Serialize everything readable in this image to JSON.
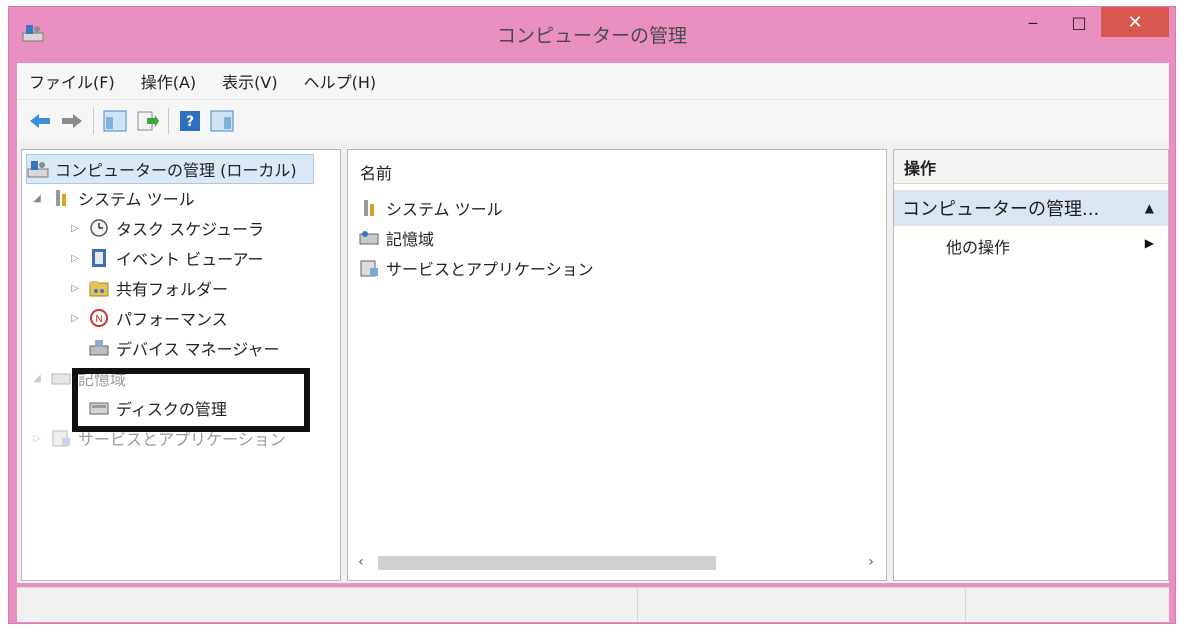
{
  "window": {
    "title": "コンピューターの管理"
  },
  "caption": {
    "minimize": "‒",
    "maximize": "□",
    "close": "✕"
  },
  "menu": [
    "ファイル(F)",
    "操作(A)",
    "表示(V)",
    "ヘルプ(H)"
  ],
  "tree": {
    "root": "コンピューターの管理 (ローカル)",
    "system_tools": "システム ツール",
    "task_scheduler": "タスク スケジューラ",
    "event_viewer": "イベント ビューアー",
    "shared_folders": "共有フォルダー",
    "performance": "パフォーマンス",
    "device_manager": "デバイス マネージャー",
    "storage": "記憶域",
    "disk_management": "ディスクの管理",
    "services_apps": "サービスとアプリケーション"
  },
  "center": {
    "column_header": "名前",
    "items": [
      "システム ツール",
      "記憶域",
      "サービスとアプリケーション"
    ]
  },
  "actions": {
    "header": "操作",
    "section": "コンピューターの管理...",
    "more_actions": "他の操作"
  },
  "colors": {
    "frame": "#e990c0",
    "close_button": "#d8584f",
    "selection": "#dbe8f5",
    "highlight_box": "#111111"
  }
}
